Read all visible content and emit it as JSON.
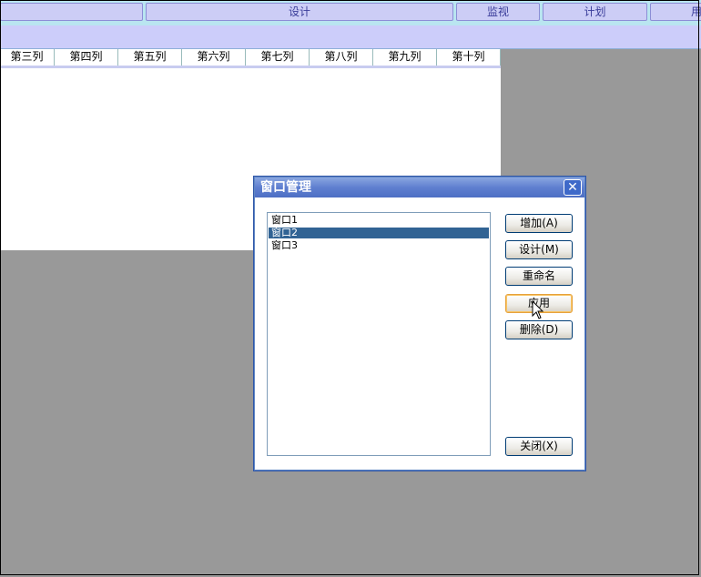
{
  "top_tabs": [
    "设计",
    "监视",
    "计划",
    "用"
  ],
  "table": {
    "columns": [
      "第三列",
      "第四列",
      "第五列",
      "第六列",
      "第七列",
      "第八列",
      "第九列",
      "第十列"
    ]
  },
  "dialog": {
    "title": "窗口管理",
    "close_glyph": "✕",
    "list_items": [
      "窗口1",
      "窗口2",
      "窗口3"
    ],
    "selected_index": 1,
    "buttons": {
      "add": "增加(A)",
      "design": "设计(M)",
      "rename": "重命名",
      "apply": "应用",
      "delete": "删除(D)",
      "close": "关闭(X)"
    }
  },
  "colors": {
    "selection": "#316394",
    "title_bar": "#5f7fd0",
    "tab_bg": "#cccdf6"
  }
}
